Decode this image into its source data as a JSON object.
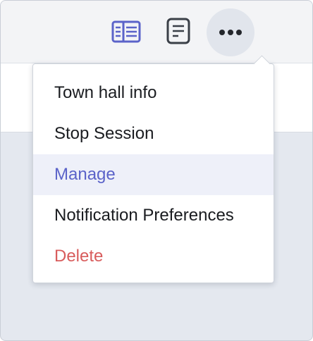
{
  "toolbar": {
    "icons": {
      "sidebar": "sidebar-panel-icon",
      "notes": "document-icon",
      "more": "more-dots-icon"
    },
    "accent_color": "#5b63c9",
    "icon_dark_color": "#3a3f47"
  },
  "menu": {
    "items": [
      {
        "label": "Town hall info",
        "state": "normal"
      },
      {
        "label": "Stop Session",
        "state": "normal"
      },
      {
        "label": "Manage",
        "state": "highlighted",
        "color": "#5b63c9"
      },
      {
        "label": "Notification Preferences",
        "state": "normal"
      },
      {
        "label": "Delete",
        "state": "danger",
        "color": "#d85c5c"
      }
    ]
  }
}
